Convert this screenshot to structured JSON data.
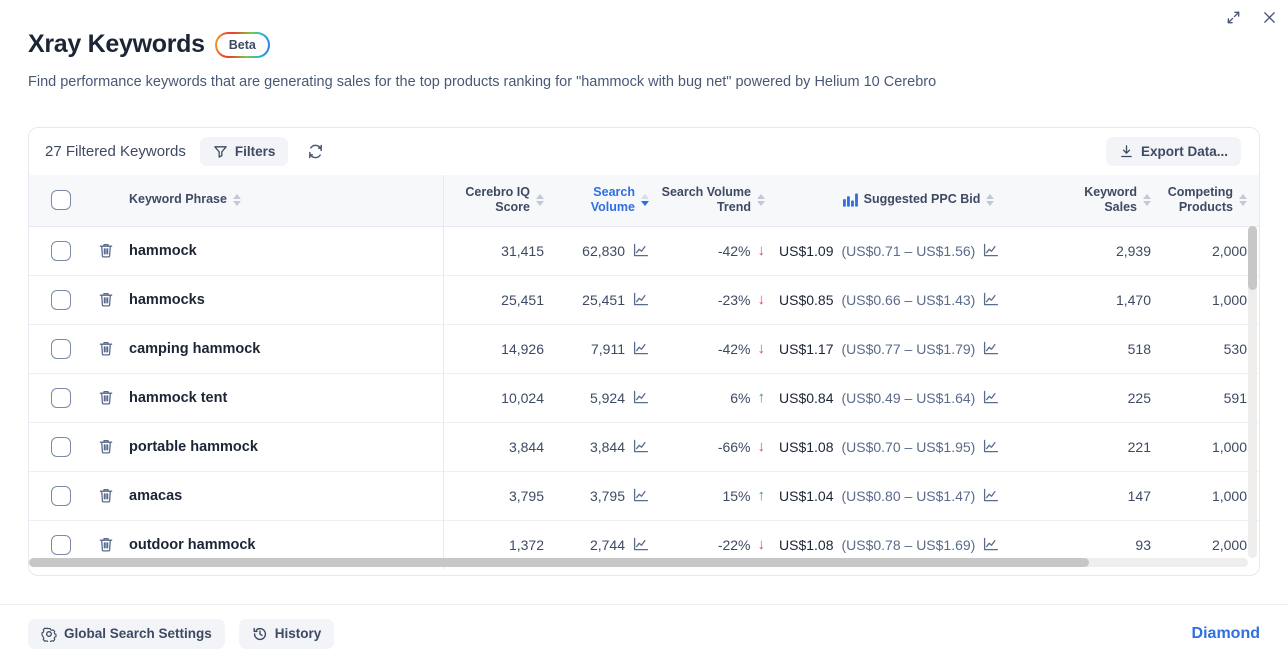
{
  "window": {
    "expand_icon": "expand-icon",
    "close_icon": "close-icon"
  },
  "header": {
    "title": "Xray Keywords",
    "badge": "Beta",
    "subtitle": "Find performance keywords that are generating sales for the top products ranking for \"hammock with bug net\" powered by Helium 10 Cerebro"
  },
  "toolbar": {
    "filtered_count": "27 Filtered Keywords",
    "filters_label": "Filters",
    "filters_icon": "funnel-icon",
    "refresh_icon": "refresh-icon",
    "export_label": "Export Data...",
    "export_icon": "download-icon"
  },
  "table": {
    "columns": [
      {
        "label": "Keyword Phrase",
        "align": "left",
        "sorted": false
      },
      {
        "label": "Cerebro IQ Score",
        "align": "right",
        "sorted": false
      },
      {
        "label": "Search Volume",
        "align": "right",
        "sorted": true,
        "direction": "desc"
      },
      {
        "label": "Search Volume Trend",
        "align": "right",
        "sorted": false
      },
      {
        "label": "Suggested PPC Bid",
        "align": "center",
        "sorted": false,
        "icon": "bar-chart-icon"
      },
      {
        "label": "Keyword Sales",
        "align": "right",
        "sorted": false
      },
      {
        "label": "Competing Products",
        "align": "right",
        "sorted": false
      }
    ],
    "select_all_checkbox": false,
    "row_delete_icon": "trash-icon",
    "sparkline_icon": "line-chart-icon",
    "rows": [
      {
        "keyword": "hammock",
        "cerebro_iq_score": "31,415",
        "search_volume": "62,830",
        "trend": "-42%",
        "trend_dir": "down",
        "ppc_bid": "US$1.09",
        "ppc_range": "(US$0.71 – US$1.56)",
        "keyword_sales": "2,939",
        "competing_products": "2,000"
      },
      {
        "keyword": "hammocks",
        "cerebro_iq_score": "25,451",
        "search_volume": "25,451",
        "trend": "-23%",
        "trend_dir": "down",
        "ppc_bid": "US$0.85",
        "ppc_range": "(US$0.66 – US$1.43)",
        "keyword_sales": "1,470",
        "competing_products": "1,000"
      },
      {
        "keyword": "camping hammock",
        "cerebro_iq_score": "14,926",
        "search_volume": "7,911",
        "trend": "-42%",
        "trend_dir": "down",
        "ppc_bid": "US$1.17",
        "ppc_range": "(US$0.77 – US$1.79)",
        "keyword_sales": "518",
        "competing_products": "530"
      },
      {
        "keyword": "hammock tent",
        "cerebro_iq_score": "10,024",
        "search_volume": "5,924",
        "trend": "6%",
        "trend_dir": "up",
        "ppc_bid": "US$0.84",
        "ppc_range": "(US$0.49 – US$1.64)",
        "keyword_sales": "225",
        "competing_products": "591"
      },
      {
        "keyword": "portable hammock",
        "cerebro_iq_score": "3,844",
        "search_volume": "3,844",
        "trend": "-66%",
        "trend_dir": "down",
        "ppc_bid": "US$1.08",
        "ppc_range": "(US$0.70 – US$1.95)",
        "keyword_sales": "221",
        "competing_products": "1,000"
      },
      {
        "keyword": "amacas",
        "cerebro_iq_score": "3,795",
        "search_volume": "3,795",
        "trend": "15%",
        "trend_dir": "up",
        "ppc_bid": "US$1.04",
        "ppc_range": "(US$0.80 – US$1.47)",
        "keyword_sales": "147",
        "competing_products": "1,000"
      },
      {
        "keyword": "outdoor hammock",
        "cerebro_iq_score": "1,372",
        "search_volume": "2,744",
        "trend": "-22%",
        "trend_dir": "down",
        "ppc_bid": "US$1.08",
        "ppc_range": "(US$0.78 – US$1.69)",
        "keyword_sales": "93",
        "competing_products": "2,000"
      }
    ]
  },
  "footer": {
    "global_search_settings_label": "Global Search Settings",
    "global_search_settings_icon": "gear-icon",
    "history_label": "History",
    "history_icon": "history-icon",
    "plan_label": "Diamond"
  },
  "colors": {
    "accent_blue": "#2f6fe0",
    "text_dark": "#1c2536",
    "text_muted": "#4a5875",
    "trend_down": "#e5484d",
    "trend_up": "#27a567",
    "header_bg": "#f7f8fa",
    "border": "#e6e9ef"
  }
}
